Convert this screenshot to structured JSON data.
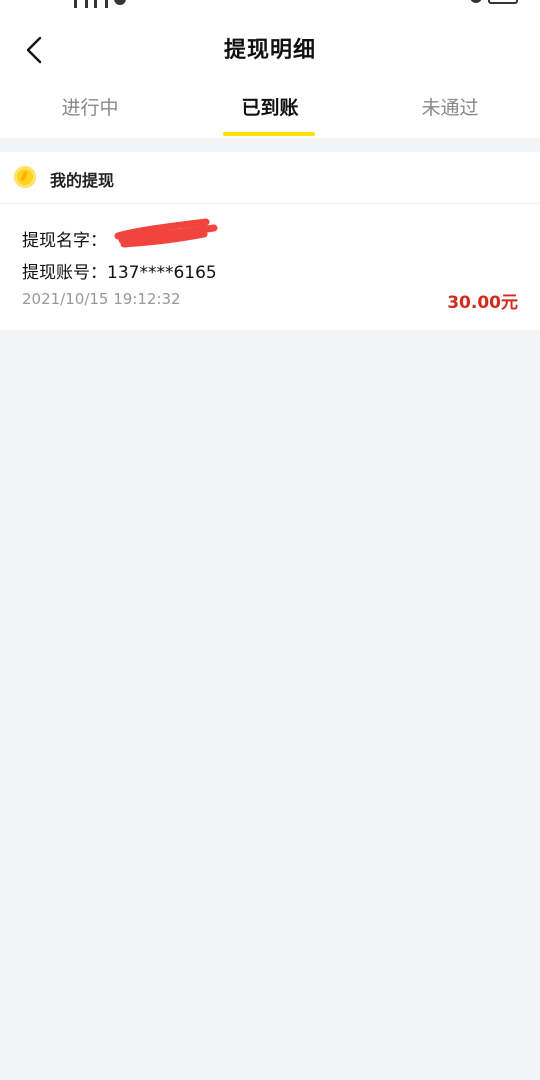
{
  "header": {
    "title": "提现明细",
    "back_icon": "chevron-left-icon"
  },
  "tabs": [
    {
      "label": "进行中",
      "active": false
    },
    {
      "label": "已到账",
      "active": true
    },
    {
      "label": "未通过",
      "active": false
    }
  ],
  "section": {
    "title": "我的提现",
    "icon": "coin-icon"
  },
  "record": {
    "name_label": "提现名字：",
    "name_value": "",
    "account_label": "提现账号：",
    "account_value": "137****6165",
    "date": "2021/10/15 19:12:32",
    "amount": "30.00元"
  },
  "colors": {
    "accent": "#ffe000",
    "amount": "#d4291c",
    "muted": "#999999",
    "background": "#f2f3f5"
  }
}
